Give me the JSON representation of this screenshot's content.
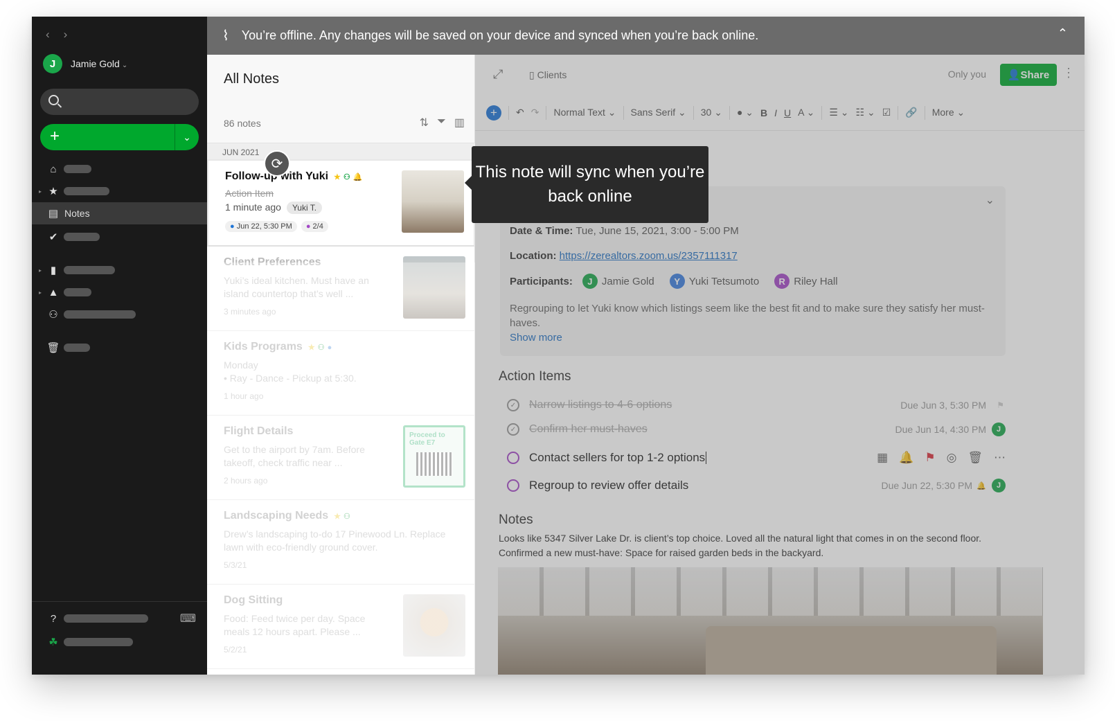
{
  "user": {
    "name": "Jamie Gold",
    "initial": "J"
  },
  "sidebar": {
    "notes_label": "Notes"
  },
  "banner": {
    "text": "You’re offline. Any changes will be saved on your device and synced when you’re back online."
  },
  "list": {
    "title": "All Notes",
    "count": "86 notes",
    "month": "JUN 2021",
    "notes": [
      {
        "title": "Follow-up with Yuki",
        "snippet": "Action Item",
        "date": "1 minute ago",
        "tag": "Yuki T.",
        "reminder": "Jun 22, 5:30 PM",
        "tasks": "2/4"
      },
      {
        "title": "Client Preferences",
        "snippet": "Yuki’s ideal kitchen. Must have an island countertop that’s well ...",
        "date": "3 minutes ago"
      },
      {
        "title": "Kids Programs",
        "snippet": "Monday\n• Ray - Dance - Pickup at 5:30.",
        "date": "1 hour ago"
      },
      {
        "title": "Flight Details",
        "snippet": "Get to the airport by 7am. Before takeoff, check traffic near ...",
        "date": "2 hours ago",
        "thumb_text": "Proceed to Gate E7"
      },
      {
        "title": "Landscaping Needs",
        "snippet": "Drew’s landscaping to-do 17 Pinewood Ln. Replace lawn with eco-friendly ground cover.",
        "date": "5/3/21"
      },
      {
        "title": "Dog Sitting",
        "snippet": "Food: Feed twice per day. Space meals 12 hours apart. Please ...",
        "date": "5/2/21"
      }
    ]
  },
  "tooltip": {
    "text": "This note will sync when you’re back online"
  },
  "editor": {
    "notebook": "Clients",
    "visibility": "Only you",
    "share_label": "Share",
    "toolbar": {
      "style": "Normal Text",
      "font": "Sans Serif",
      "size": "30",
      "more": "More"
    },
    "meta": {
      "datetime_label": "Date & Time:",
      "datetime": "Tue, June 15, 2021, 3:00 - 5:00 PM",
      "location_label": "Location:",
      "location": "https://zerealtors.zoom.us/2357111317",
      "participants_label": "Participants:",
      "participants": [
        {
          "initial": "J",
          "name": "Jamie Gold",
          "color": "#1aa64a"
        },
        {
          "initial": "Y",
          "name": "Yuki Tetsumoto",
          "color": "#3b7ddd"
        },
        {
          "initial": "R",
          "name": "Riley Hall",
          "color": "#a347c6"
        }
      ],
      "description": "Regrouping to let Yuki know which listings seem like the best fit and to make sure they satisfy her must-haves.",
      "show_more": "Show more"
    },
    "action_items_title": "Action Items",
    "action_items": [
      {
        "text": "Narrow listings to 4-6 options",
        "due": "Due Jun 3, 5:30 PM",
        "done": true
      },
      {
        "text": "Confirm her must-haves",
        "due": "Due Jun 14, 4:30 PM",
        "done": true
      },
      {
        "text": "Contact sellers for top 1-2 options",
        "due": "",
        "done": false
      },
      {
        "text": "Regroup to review offer details",
        "due": "Due Jun 22, 5:30 PM",
        "done": false
      }
    ],
    "notes_title": "Notes",
    "notes_text": "Looks like 5347 Silver Lake Dr. is client’s top choice. Loved all the natural light that comes in on the second floor. Confirmed a new must-have: Space for raised garden beds in the backyard."
  }
}
